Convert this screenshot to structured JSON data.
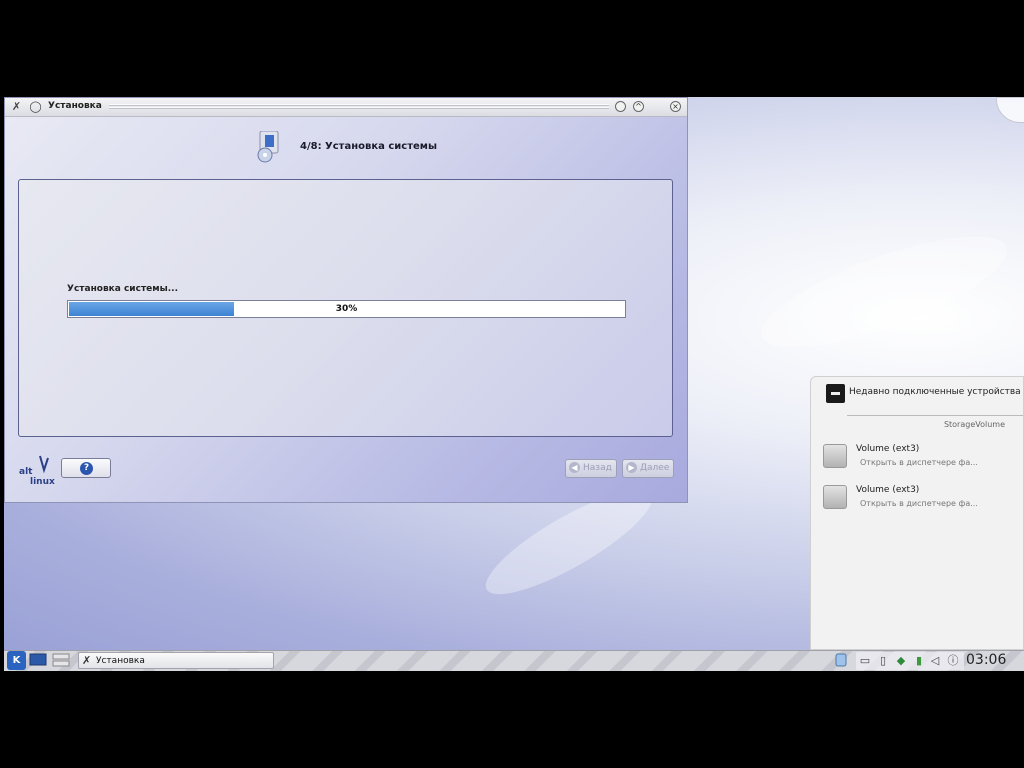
{
  "window": {
    "title": "Установка",
    "step_title": "4/8: Установка системы",
    "status_text": "Установка системы...",
    "progress_percent_label": "30%",
    "progress_fraction": 0.3,
    "back_label": "Назад",
    "next_label": "Далее",
    "logo_text": "alt linux"
  },
  "device_notifier": {
    "header": "Недавно подключенные устройства",
    "section": "StorageVolume",
    "devices": [
      {
        "name": "Volume (ext3)",
        "action": "Открыть в диспетчере фа..."
      },
      {
        "name": "Volume (ext3)",
        "action": "Открыть в диспетчере фа..."
      }
    ]
  },
  "taskbar": {
    "task_label": "Установка",
    "clock": "03:06"
  },
  "colors": {
    "progress_fill": "#3d83d3",
    "kmenu": "#2a63c0"
  }
}
